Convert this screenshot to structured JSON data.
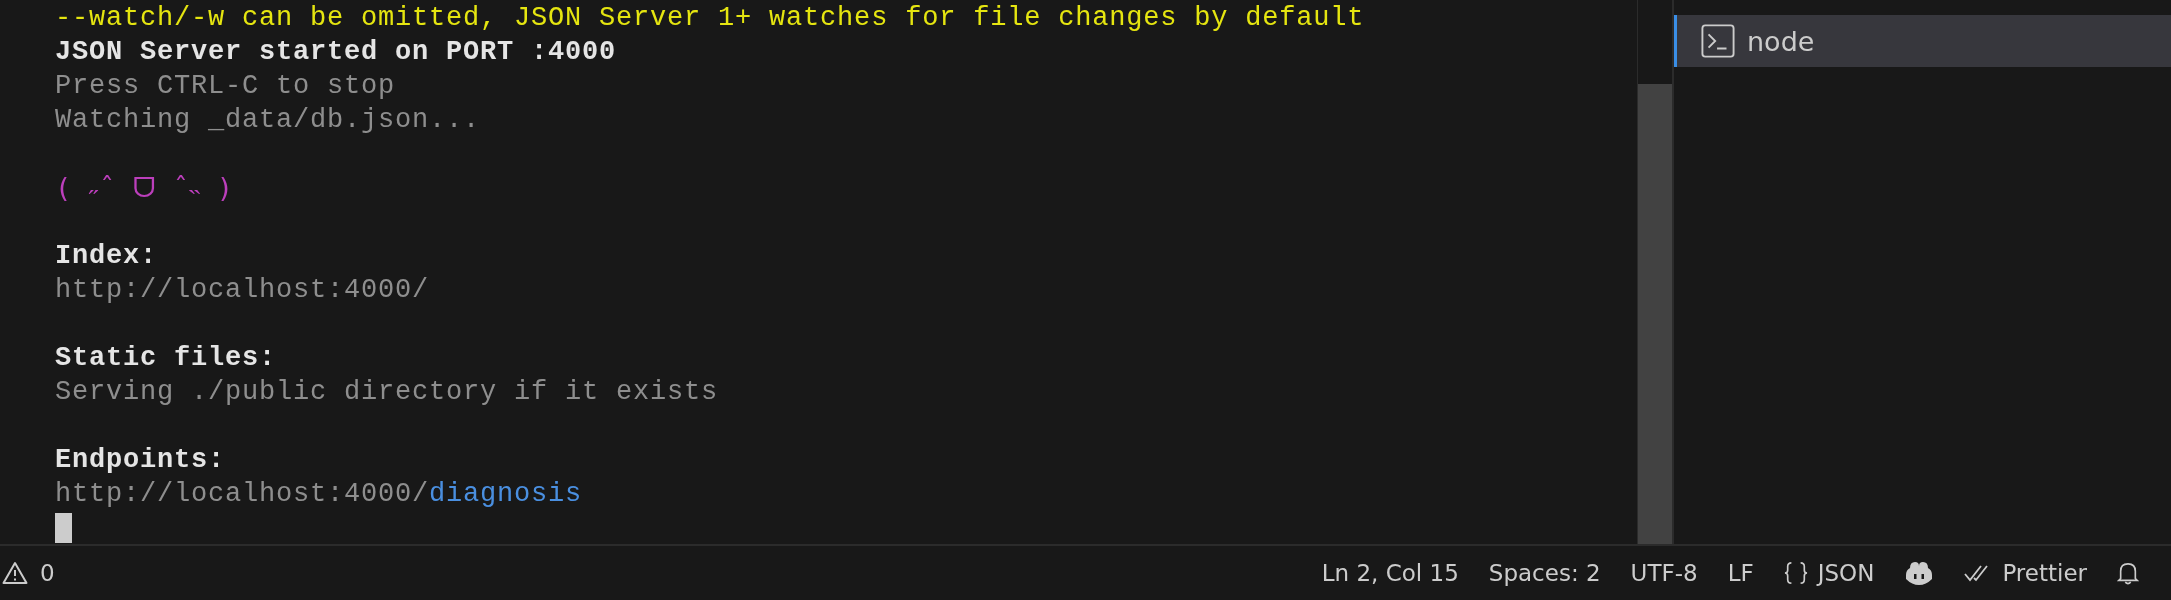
{
  "terminal": {
    "lines": [
      {
        "kind": "warning",
        "text": "--watch/-w can be omitted, JSON Server 1+ watches for file changes by default"
      },
      {
        "kind": "bold",
        "text": "JSON Server started on PORT :4000"
      },
      {
        "kind": "muted",
        "text": "Press CTRL-C to stop"
      },
      {
        "kind": "muted",
        "text": "Watching _data/db.json..."
      },
      {
        "kind": "blank"
      },
      {
        "kind": "art",
        "text": "( ˶ˆ ᗜ ˆ˵ )"
      },
      {
        "kind": "blank"
      },
      {
        "kind": "bold",
        "text": "Index:"
      },
      {
        "kind": "muted",
        "text": "http://localhost:4000/"
      },
      {
        "kind": "blank"
      },
      {
        "kind": "bold",
        "text": "Static files:"
      },
      {
        "kind": "muted",
        "text": "Serving ./public directory if it exists"
      },
      {
        "kind": "blank"
      },
      {
        "kind": "bold",
        "text": "Endpoints:"
      },
      {
        "kind": "endpoint",
        "text": "http://localhost:4000/",
        "highlight": "diagnosis"
      },
      {
        "kind": "cursor"
      }
    ]
  },
  "terminal_list": [
    {
      "label": "node",
      "selected": true
    }
  ],
  "status_bar": {
    "problems": "0",
    "position": "Ln 2, Col 15",
    "indentation": "Spaces: 2",
    "encoding": "UTF-8",
    "line_endings": "LF",
    "language": "JSON",
    "formatter": "Prettier"
  }
}
